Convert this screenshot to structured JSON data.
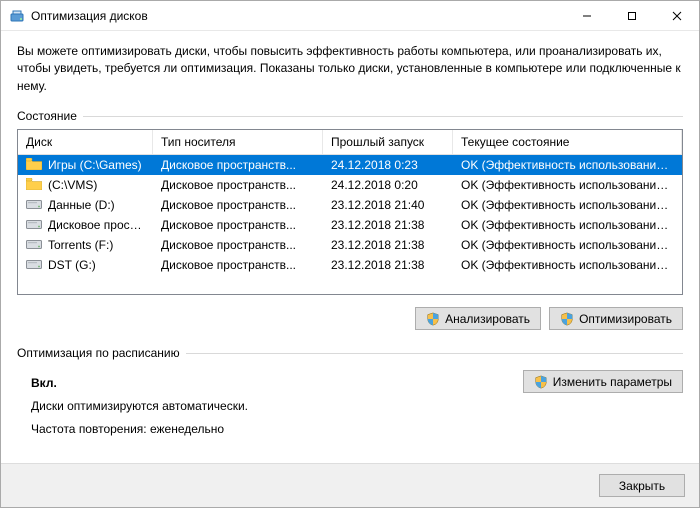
{
  "window": {
    "title": "Оптимизация дисков"
  },
  "intro": "Вы можете оптимизировать диски, чтобы повысить эффективность работы  компьютера, или проанализировать их, чтобы увидеть, требуется ли оптимизация. Показаны только диски, установленные в компьютере или подключенные к нему.",
  "section_status": "Состояние",
  "columns": {
    "disk": "Диск",
    "media": "Тип носителя",
    "last": "Прошлый запуск",
    "status": "Текущее состояние"
  },
  "rows": [
    {
      "name": "Игры (C:\\Games)",
      "media": "Дисковое пространств...",
      "last": "24.12.2018 0:23",
      "status": "OK (Эффективность использования про...",
      "selected": true,
      "icon": "folder"
    },
    {
      "name": "(C:\\VMS)",
      "media": "Дисковое пространств...",
      "last": "24.12.2018 0:20",
      "status": "OK (Эффективность использования про...",
      "selected": false,
      "icon": "folder"
    },
    {
      "name": "Данные (D:)",
      "media": "Дисковое пространств...",
      "last": "23.12.2018 21:40",
      "status": "OK (Эффективность использования про...",
      "selected": false,
      "icon": "drive"
    },
    {
      "name": "Дисковое простран...",
      "media": "Дисковое пространств...",
      "last": "23.12.2018 21:38",
      "status": "OK (Эффективность использования про...",
      "selected": false,
      "icon": "drive"
    },
    {
      "name": "Torrents (F:)",
      "media": "Дисковое пространств...",
      "last": "23.12.2018 21:38",
      "status": "OK (Эффективность использования про...",
      "selected": false,
      "icon": "drive"
    },
    {
      "name": "DST (G:)",
      "media": "Дисковое пространств...",
      "last": "23.12.2018 21:38",
      "status": "OK (Эффективность использования про...",
      "selected": false,
      "icon": "drive"
    }
  ],
  "buttons": {
    "analyze": "Анализировать",
    "optimize": "Оптимизировать",
    "change": "Изменить параметры",
    "close": "Закрыть"
  },
  "section_schedule": "Оптимизация по расписанию",
  "schedule": {
    "enabled": "Вкл.",
    "auto": "Диски оптимизируются автоматически.",
    "freq": "Частота повторения: еженедельно"
  }
}
